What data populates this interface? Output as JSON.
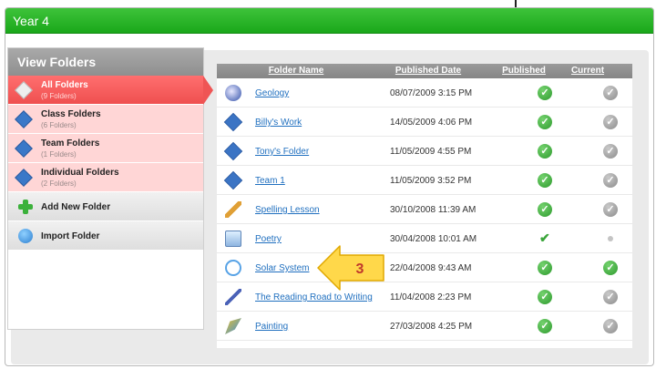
{
  "window": {
    "title": "Year 4"
  },
  "sidebar": {
    "header": "View Folders",
    "folders": [
      {
        "label": "All Folders",
        "count": "(9 Folders)",
        "selected": true
      },
      {
        "label": "Class Folders",
        "count": "(6 Folders)",
        "selected": false
      },
      {
        "label": "Team Folders",
        "count": "(1 Folders)",
        "selected": false
      },
      {
        "label": "Individual Folders",
        "count": "(2 Folders)",
        "selected": false
      }
    ],
    "actions": [
      {
        "label": "Add New Folder",
        "icon": "plus-icon"
      },
      {
        "label": "Import Folder",
        "icon": "import-icon"
      }
    ]
  },
  "table": {
    "columns": [
      "Folder Name",
      "Published Date",
      "Published",
      "Current"
    ],
    "rows": [
      {
        "name": "Geology",
        "date": "08/07/2009 3:15 PM",
        "icon": "globe-icon",
        "published": "check",
        "current": "check-grey"
      },
      {
        "name": "Billy's Work",
        "date": "14/05/2009 4:06 PM",
        "icon": "folder-diamond-icon",
        "published": "check",
        "current": "check-grey"
      },
      {
        "name": "Tony's Folder",
        "date": "11/05/2009 4:55 PM",
        "icon": "folder-diamond-icon",
        "published": "check",
        "current": "check-grey"
      },
      {
        "name": "Team 1",
        "date": "11/05/2009 3:52 PM",
        "icon": "folder-diamond-icon",
        "published": "check",
        "current": "check-grey"
      },
      {
        "name": "Spelling Lesson",
        "date": "30/10/2008 11:39 AM",
        "icon": "pencil-icon",
        "published": "check",
        "current": "check-grey"
      },
      {
        "name": "Poetry",
        "date": "30/04/2008 10:01 AM",
        "icon": "cube-icon",
        "published": "tick",
        "current": "dot"
      },
      {
        "name": "Solar System",
        "date": "22/04/2008 9:43 AM",
        "icon": "atom-icon",
        "published": "check",
        "current": "check"
      },
      {
        "name": "The Reading Road to Writing",
        "date": "11/04/2008 2:23 PM",
        "icon": "pen-icon",
        "published": "check",
        "current": "check-grey"
      },
      {
        "name": "Painting",
        "date": "27/03/2008 4:25 PM",
        "icon": "paint-icon",
        "published": "check",
        "current": "check-grey"
      }
    ]
  },
  "callout": {
    "number": "3"
  },
  "colors": {
    "titlebar": "#1aa81a",
    "selected": "#ef4f4f",
    "link": "#1f6fbf",
    "callout": "#ffd84a"
  }
}
